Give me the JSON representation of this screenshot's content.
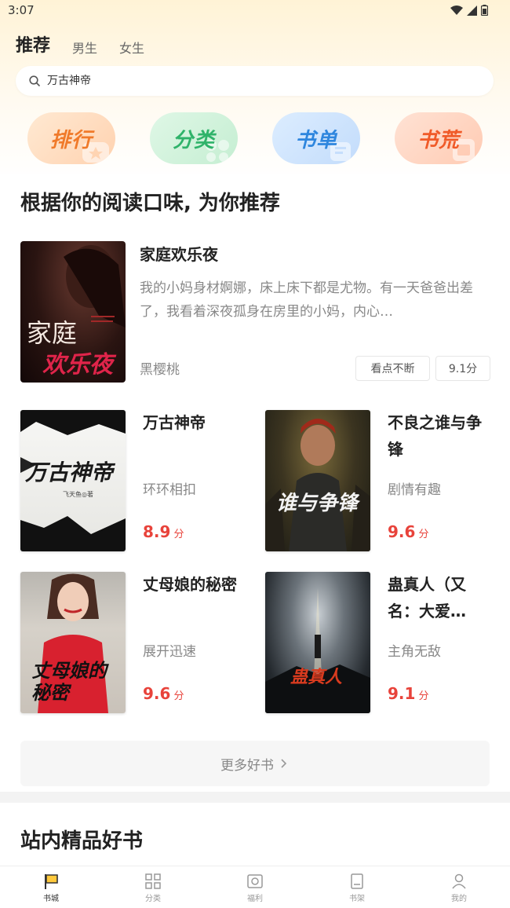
{
  "status": {
    "time": "3:07"
  },
  "tabs": [
    {
      "label": "推荐",
      "active": true
    },
    {
      "label": "男生",
      "active": false
    },
    {
      "label": "女生",
      "active": false
    }
  ],
  "search": {
    "placeholder": "万古神帝"
  },
  "shortcuts": [
    {
      "label": "排行",
      "color": "#f07a2a"
    },
    {
      "label": "分类",
      "color": "#2fb36a"
    },
    {
      "label": "书单",
      "color": "#2e86de"
    },
    {
      "label": "书荒",
      "color": "#f05a28"
    }
  ],
  "recommend": {
    "title": "根据你的阅读口味, 为你推荐",
    "featured": {
      "title": "家庭欢乐夜",
      "desc": "我的小妈身材婀娜，床上床下都是尤物。有一天爸爸出差了，我看着深夜孤身在房里的小妈，内心…",
      "author": "黑樱桃",
      "tags": [
        "看点不断",
        "9.1分"
      ],
      "cover_text": [
        "家庭",
        "欢乐夜"
      ]
    },
    "books": [
      {
        "title": "万古神帝",
        "tag": "环环相扣",
        "score": "8.9",
        "cover_text": "万古神帝",
        "cover_author": "飞天鱼◎著"
      },
      {
        "title": "不良之谁与争锋",
        "tag": "剧情有趣",
        "score": "9.6",
        "cover_text": "谁与争锋"
      },
      {
        "title": "丈母娘的秘密",
        "tag": "展开迅速",
        "score": "9.6",
        "cover_text": "丈母娘的秘密"
      },
      {
        "title": "蛊真人（又名：大爱仙尊）",
        "title_display": "蛊真人（又名：大爱…",
        "tag": "主角无敌",
        "score": "9.1",
        "cover_text": "蛊真人"
      }
    ],
    "score_unit": "分",
    "more_label": "更多好书"
  },
  "section2": {
    "title": "站内精品好书"
  },
  "bottom_nav": [
    {
      "label": "书城",
      "icon": "bookstore-flag-icon",
      "active": true
    },
    {
      "label": "分类",
      "icon": "category-grid-icon",
      "active": false
    },
    {
      "label": "福利",
      "icon": "gift-icon",
      "active": false
    },
    {
      "label": "书架",
      "icon": "bookshelf-icon",
      "active": false
    },
    {
      "label": "我的",
      "icon": "profile-icon",
      "active": false
    }
  ]
}
